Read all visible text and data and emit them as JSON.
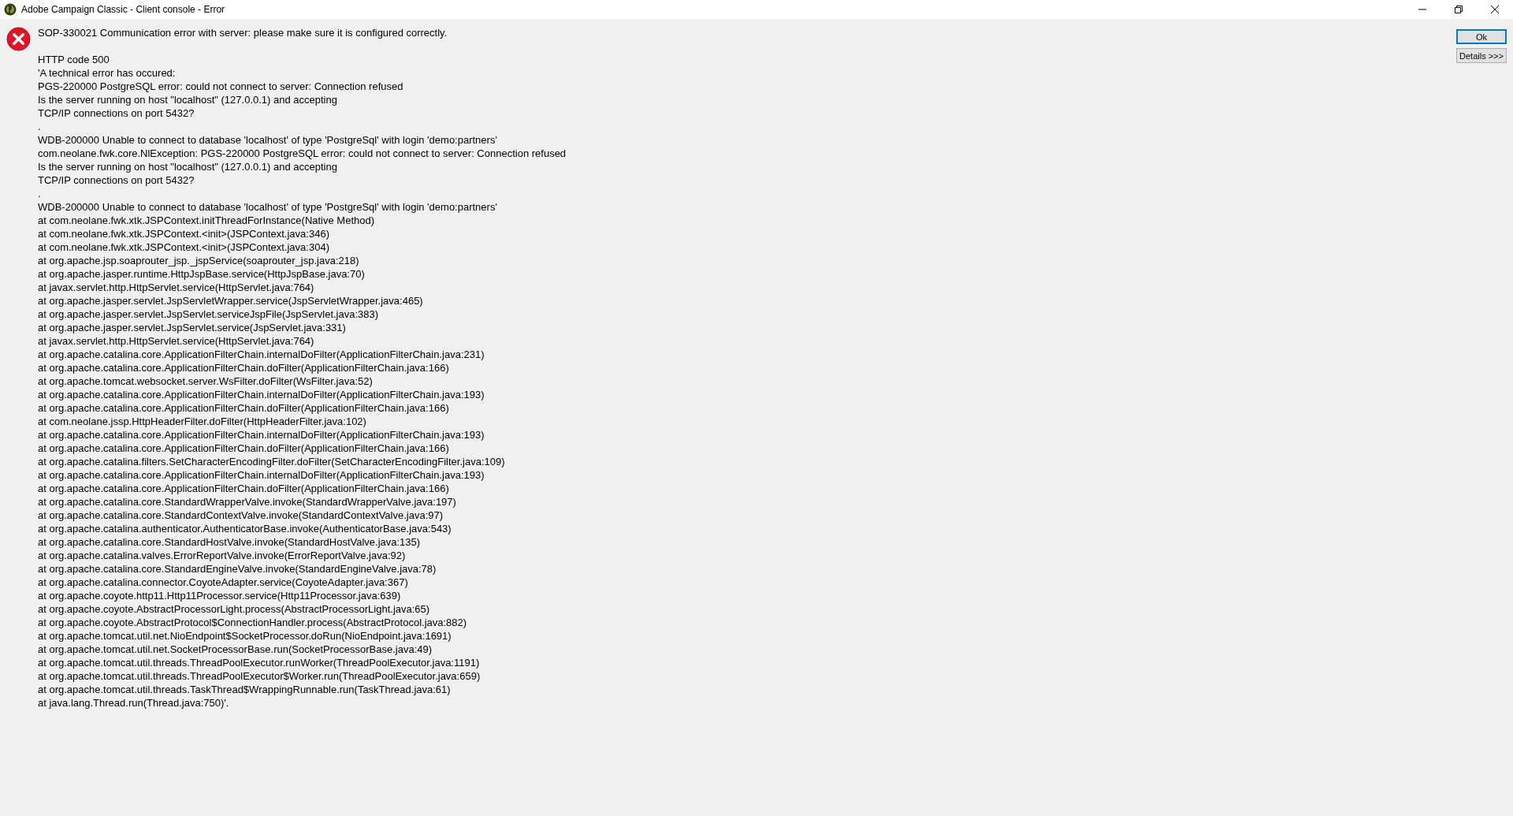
{
  "window": {
    "title": "Adobe Campaign Classic - Client console - Error"
  },
  "message": "SOP-330021 Communication error with server: please make sure it is configured correctly.",
  "details": [
    "HTTP code 500",
    "'A technical error has occured:",
    "PGS-220000 PostgreSQL error: could not connect to server: Connection refused",
    "Is the server running on host \"localhost\" (127.0.0.1) and accepting",
    "TCP/IP connections on port 5432?",
    ".",
    "WDB-200000 Unable to connect to database 'localhost' of type 'PostgreSql' with login 'demo:partners'",
    "com.neolane.fwk.core.NlException: PGS-220000 PostgreSQL error: could not connect to server: Connection refused",
    "Is the server running on host \"localhost\" (127.0.0.1) and accepting",
    "TCP/IP connections on port 5432?",
    ".",
    "WDB-200000 Unable to connect to database 'localhost' of type 'PostgreSql' with login 'demo:partners'",
    "at com.neolane.fwk.xtk.JSPContext.initThreadForInstance(Native Method)",
    "at com.neolane.fwk.xtk.JSPContext.<init>(JSPContext.java:346)",
    "at com.neolane.fwk.xtk.JSPContext.<init>(JSPContext.java:304)",
    "at org.apache.jsp.soaprouter_jsp._jspService(soaprouter_jsp.java:218)",
    "at org.apache.jasper.runtime.HttpJspBase.service(HttpJspBase.java:70)",
    "at javax.servlet.http.HttpServlet.service(HttpServlet.java:764)",
    "at org.apache.jasper.servlet.JspServletWrapper.service(JspServletWrapper.java:465)",
    "at org.apache.jasper.servlet.JspServlet.serviceJspFile(JspServlet.java:383)",
    "at org.apache.jasper.servlet.JspServlet.service(JspServlet.java:331)",
    "at javax.servlet.http.HttpServlet.service(HttpServlet.java:764)",
    "at org.apache.catalina.core.ApplicationFilterChain.internalDoFilter(ApplicationFilterChain.java:231)",
    "at org.apache.catalina.core.ApplicationFilterChain.doFilter(ApplicationFilterChain.java:166)",
    "at org.apache.tomcat.websocket.server.WsFilter.doFilter(WsFilter.java:52)",
    "at org.apache.catalina.core.ApplicationFilterChain.internalDoFilter(ApplicationFilterChain.java:193)",
    "at org.apache.catalina.core.ApplicationFilterChain.doFilter(ApplicationFilterChain.java:166)",
    "at com.neolane.jssp.HttpHeaderFilter.doFilter(HttpHeaderFilter.java:102)",
    "at org.apache.catalina.core.ApplicationFilterChain.internalDoFilter(ApplicationFilterChain.java:193)",
    "at org.apache.catalina.core.ApplicationFilterChain.doFilter(ApplicationFilterChain.java:166)",
    "at org.apache.catalina.filters.SetCharacterEncodingFilter.doFilter(SetCharacterEncodingFilter.java:109)",
    "at org.apache.catalina.core.ApplicationFilterChain.internalDoFilter(ApplicationFilterChain.java:193)",
    "at org.apache.catalina.core.ApplicationFilterChain.doFilter(ApplicationFilterChain.java:166)",
    "at org.apache.catalina.core.StandardWrapperValve.invoke(StandardWrapperValve.java:197)",
    "at org.apache.catalina.core.StandardContextValve.invoke(StandardContextValve.java:97)",
    "at org.apache.catalina.authenticator.AuthenticatorBase.invoke(AuthenticatorBase.java:543)",
    "at org.apache.catalina.core.StandardHostValve.invoke(StandardHostValve.java:135)",
    "at org.apache.catalina.valves.ErrorReportValve.invoke(ErrorReportValve.java:92)",
    "at org.apache.catalina.core.StandardEngineValve.invoke(StandardEngineValve.java:78)",
    "at org.apache.catalina.connector.CoyoteAdapter.service(CoyoteAdapter.java:367)",
    "at org.apache.coyote.http11.Http11Processor.service(Http11Processor.java:639)",
    "at org.apache.coyote.AbstractProcessorLight.process(AbstractProcessorLight.java:65)",
    "at org.apache.coyote.AbstractProtocol$ConnectionHandler.process(AbstractProtocol.java:882)",
    "at org.apache.tomcat.util.net.NioEndpoint$SocketProcessor.doRun(NioEndpoint.java:1691)",
    "at org.apache.tomcat.util.net.SocketProcessorBase.run(SocketProcessorBase.java:49)",
    "at org.apache.tomcat.util.threads.ThreadPoolExecutor.runWorker(ThreadPoolExecutor.java:1191)",
    "at org.apache.tomcat.util.threads.ThreadPoolExecutor$Worker.run(ThreadPoolExecutor.java:659)",
    "at org.apache.tomcat.util.threads.TaskThread$WrappingRunnable.run(TaskThread.java:61)",
    "at java.lang.Thread.run(Thread.java:750)'."
  ],
  "buttons": [
    {
      "label": "Ok",
      "default": true
    },
    {
      "label": "Details >>>",
      "default": false
    }
  ]
}
